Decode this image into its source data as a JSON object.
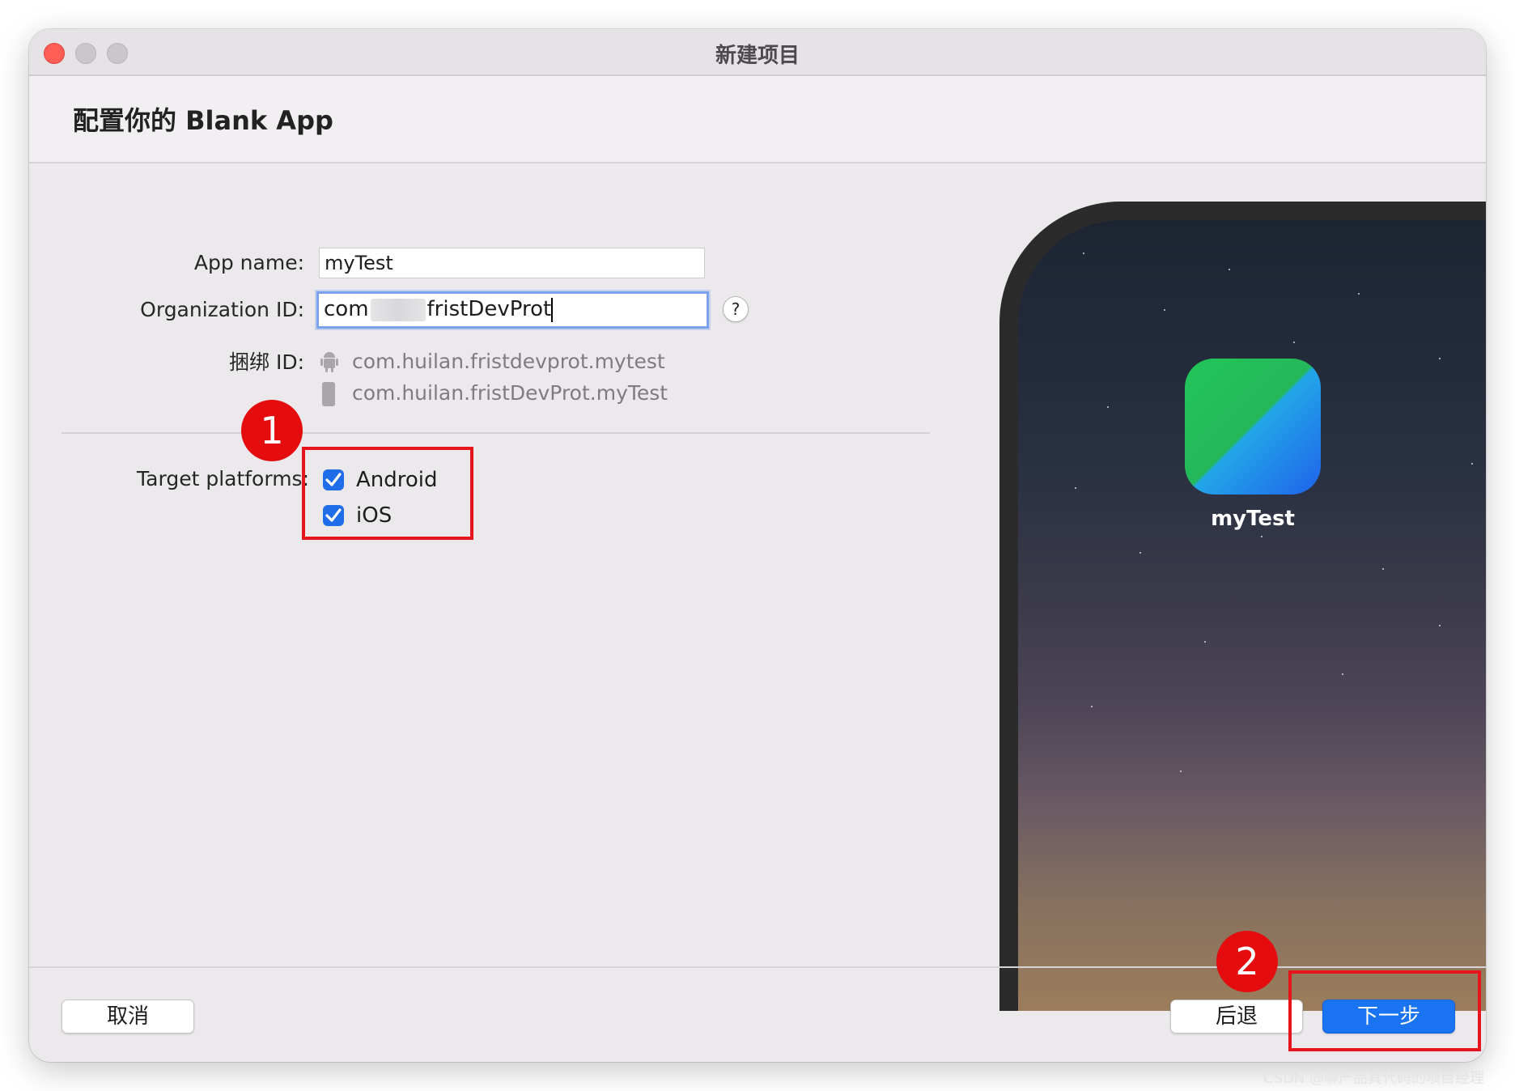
{
  "window": {
    "title": "新建项目"
  },
  "header": {
    "title": "配置你的 Blank App"
  },
  "form": {
    "app_name_label": "App name:",
    "app_name_value": "myTest",
    "org_id_label": "Organization ID:",
    "org_id_prefix": "com",
    "org_id_suffix": "fristDevProt",
    "help_label": "?",
    "bundle_label": "捆绑 ID:",
    "bundle_android": "com.huilan.fristdevprot.mytest",
    "bundle_ios": "com.huilan.fristDevProt.myTest",
    "target_label": "Target platforms:",
    "platforms": [
      {
        "label": "Android",
        "checked": true,
        "icon": "checkmark-icon"
      },
      {
        "label": "iOS",
        "checked": true,
        "icon": "checkmark-icon"
      }
    ]
  },
  "preview": {
    "app_name": "myTest"
  },
  "annotations": {
    "badge1": "1",
    "badge2": "2",
    "highlight_color": "#e8141b"
  },
  "footer": {
    "cancel": "取消",
    "back": "后退",
    "next": "下一步"
  },
  "watermark": "CSDN @聊产品其代码的项目经理"
}
